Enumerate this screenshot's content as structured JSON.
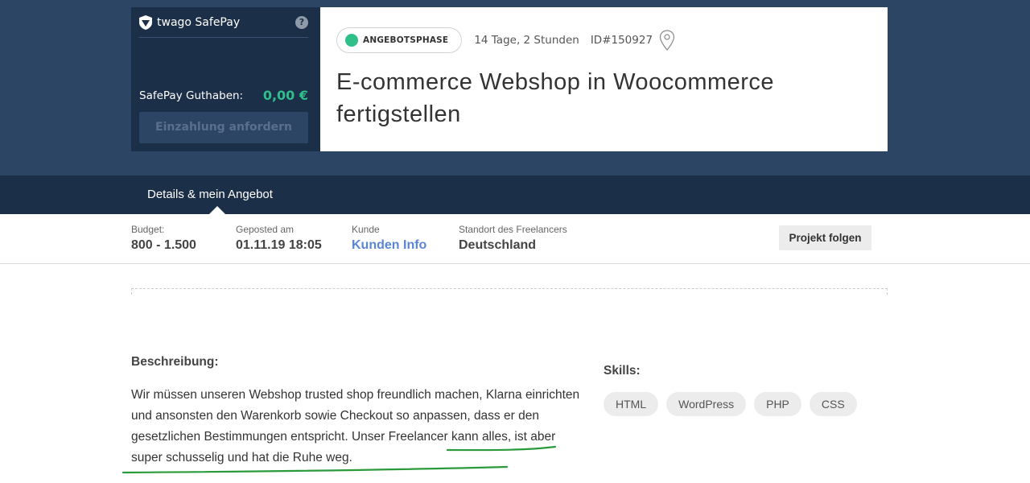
{
  "safepay": {
    "brand": "twago SafePay",
    "help": "?",
    "balance_label": "SafePay Guthaben:",
    "balance_value": "0,00 €",
    "request_button": "Einzahlung anfordern"
  },
  "project": {
    "phase": "ANGEBOTSPHASE",
    "time_left": "14 Tage, 2 Stunden",
    "id": "ID#150927",
    "title_line1": "E-commerce Webshop in Woocommerce",
    "title_line2": "fertigstellen"
  },
  "tabs": [
    {
      "label": "Details & mein Angebot",
      "active": true
    }
  ],
  "info": {
    "budget_label": "Budget:",
    "budget_value": "800 - 1.500",
    "posted_label": "Geposted am",
    "posted_value": "01.11.19 18:05",
    "client_label": "Kunde",
    "client_value": "Kunden Info",
    "location_label": "Standort des Freelancers",
    "location_value": "Deutschland",
    "follow_button": "Projekt folgen"
  },
  "description": {
    "heading": "Beschreibung:",
    "text": "Wir müssen unseren Webshop trusted shop freundlich machen, Klarna einrichten und ansonsten den Warenkorb sowie Checkout so anpassen, dass er den gesetzlichen Bestimmungen entspricht. Unser Freelancer kann alles, ist aber super schusselig und hat die Ruhe weg."
  },
  "skills": {
    "heading": "Skills:",
    "items": [
      "HTML",
      "WordPress",
      "PHP",
      "CSS"
    ]
  },
  "colors": {
    "hero_bg": "#2d4565",
    "dark_bg": "#1c2f48",
    "accent_green": "#2ebf8a",
    "link_blue": "#5b86d6",
    "annotation_green": "#2a9a3a"
  }
}
